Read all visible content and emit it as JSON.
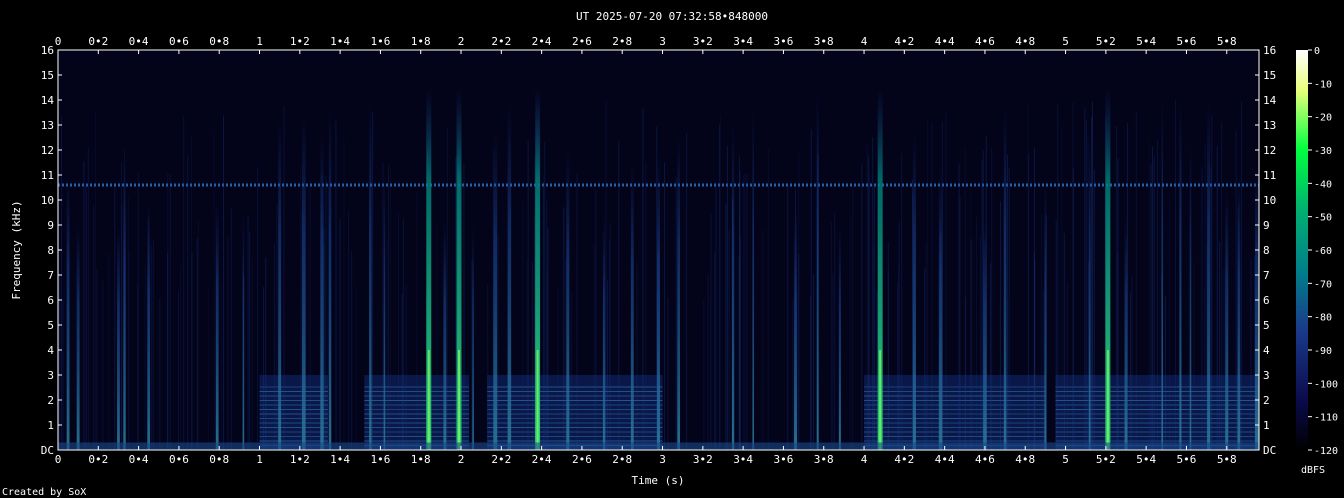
{
  "chart_data": {
    "type": "heatmap",
    "title": "UT 2025-07-20 07:32:58•848000",
    "xlabel": "Time (s)",
    "ylabel": "Frequency (kHz)",
    "xlim": [
      0,
      5.96
    ],
    "ylim": [
      0,
      16
    ],
    "x_ticks": [
      "0",
      "0•2",
      "0•4",
      "0•6",
      "0•8",
      "1",
      "1•2",
      "1•4",
      "1•6",
      "1•8",
      "2",
      "2•2",
      "2•4",
      "2•6",
      "2•8",
      "3",
      "3•2",
      "3•4",
      "3•6",
      "3•8",
      "4",
      "4•2",
      "4•4",
      "4•6",
      "4•8",
      "5",
      "5•2",
      "5•4",
      "5•6",
      "5•8"
    ],
    "y_ticks": [
      "DC",
      "1",
      "2",
      "3",
      "4",
      "5",
      "6",
      "7",
      "8",
      "9",
      "10",
      "11",
      "12",
      "13",
      "14",
      "15",
      "16"
    ],
    "colorbar": {
      "label": "dBFS",
      "ticks": [
        "0",
        "-10",
        "-20",
        "-30",
        "-40",
        "-50",
        "-60",
        "-70",
        "-80",
        "-90",
        "-100",
        "-110",
        "-120"
      ],
      "colors": [
        "#ffffff",
        "#e8ff7a",
        "#00ff40",
        "#00b070",
        "#00808a",
        "#1a3a8a",
        "#0a0a4a",
        "#000000"
      ]
    },
    "noise_floor_dbfs": -110,
    "features": {
      "tone_band_khz": 10.6,
      "transients_s": [
        0.05,
        0.1,
        0.3,
        0.33,
        0.45,
        0.79,
        0.92,
        1.1,
        1.22,
        1.31,
        1.35,
        1.55,
        1.62,
        1.84,
        1.92,
        1.99,
        2.06,
        2.17,
        2.24,
        2.38,
        2.53,
        2.71,
        2.85,
        2.98,
        3.08,
        3.35,
        3.45,
        3.66,
        3.77,
        3.88,
        4.08,
        4.25,
        4.38,
        4.6,
        4.7,
        4.9,
        5.12,
        5.21,
        5.3,
        5.48,
        5.57,
        5.62,
        5.71,
        5.8,
        5.86,
        5.95
      ],
      "strong_transients_s": [
        1.84,
        1.99,
        2.38,
        4.08,
        5.21
      ],
      "harmonic_regions_s": [
        [
          1.0,
          1.34
        ],
        [
          1.52,
          2.04
        ],
        [
          2.13,
          3.0
        ],
        [
          4.0,
          4.9
        ],
        [
          4.95,
          5.96
        ]
      ]
    }
  },
  "credit": "Created by SoX"
}
